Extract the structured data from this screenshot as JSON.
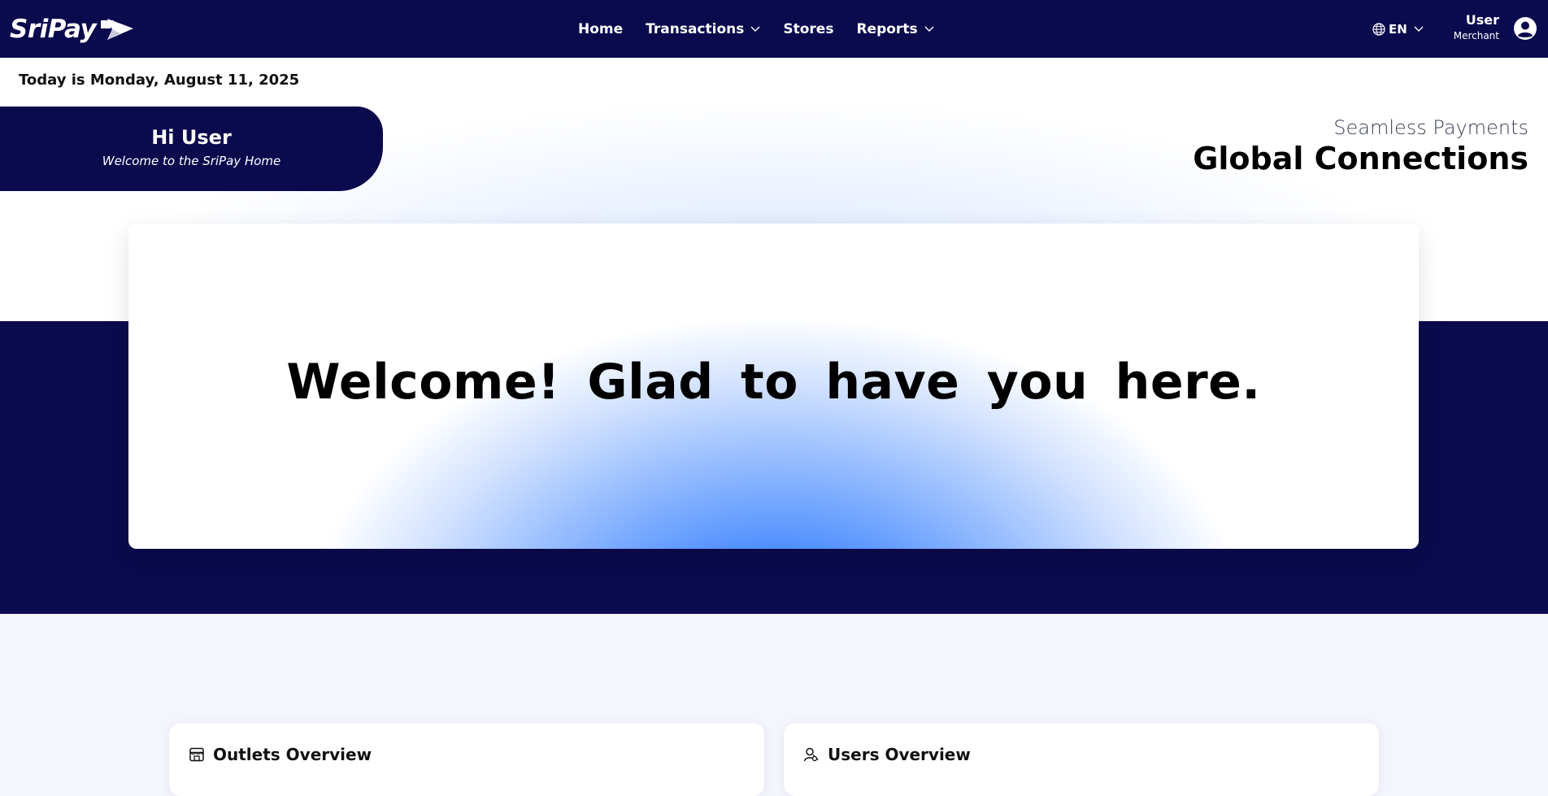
{
  "brand": {
    "name": "SriPay",
    "navy": "#0b0a4d",
    "accent": "#1d70ff"
  },
  "nav": {
    "links": [
      {
        "label": "Home"
      },
      {
        "label": "Transactions"
      },
      {
        "label": "Stores"
      },
      {
        "label": "Reports"
      }
    ],
    "language": {
      "label": "EN",
      "icon": "globe-icon"
    },
    "user": {
      "name": "User",
      "role": "Merchant",
      "icon": "user-circle-icon"
    }
  },
  "date_text": "Today is Monday, August 11, 2025",
  "greeting": {
    "title": "Hi User",
    "subtitle": "Welcome to the SriPay Home"
  },
  "tagline": {
    "sub": "Seamless Payments",
    "main": "Global Connections"
  },
  "welcome": {
    "text": "Welcome! Glad to have you here."
  },
  "overview": {
    "outlets": {
      "title": "Outlets Overview",
      "icon": "store-icon"
    },
    "users": {
      "title": "Users Overview",
      "icon": "users-icon"
    }
  }
}
